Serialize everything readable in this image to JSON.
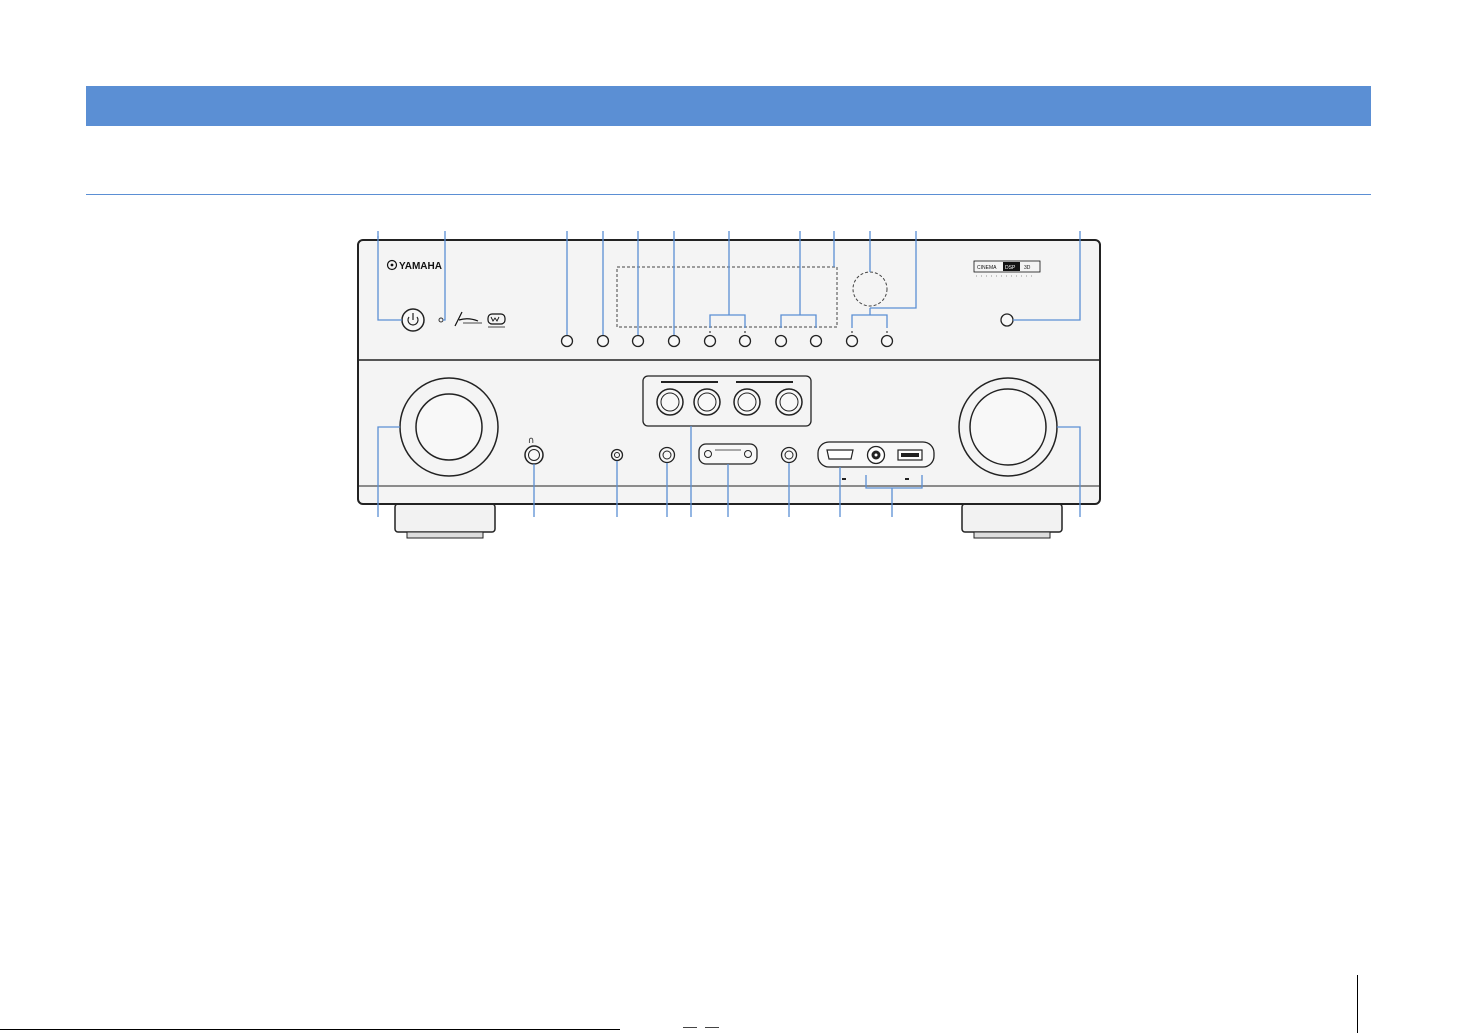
{
  "brand": {
    "name": "YAMAHA",
    "cinema_dsp_badge": {
      "part1": "CINEMA",
      "part2": "DSP",
      "part3": "3D"
    }
  },
  "colors": {
    "header_bar": "#5b8fd4",
    "callout_line": "#5b8fd4",
    "panel_fill": "#f4f4f4",
    "panel_stroke": "#222222"
  },
  "icons": {
    "power": "power-icon",
    "headphone": "headphone-icon",
    "network_logo": "network-logo-icon",
    "wifi_logo": "wifi-logo-icon"
  }
}
